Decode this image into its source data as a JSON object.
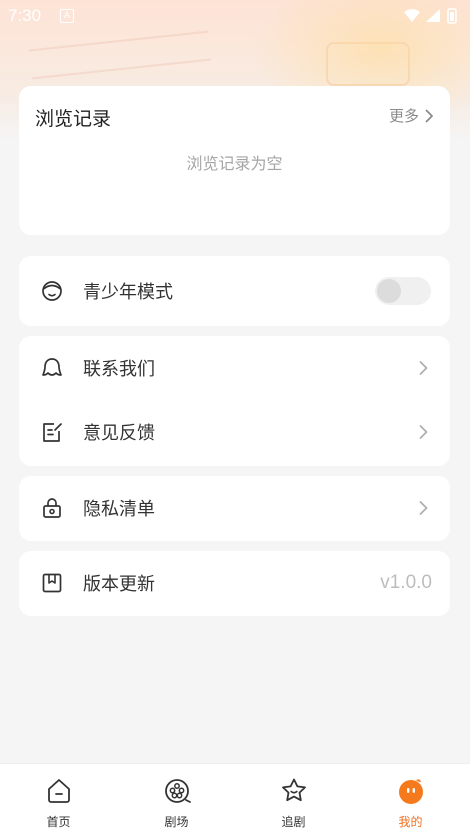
{
  "status_bar": {
    "time": "7:30",
    "indicator": "A"
  },
  "history": {
    "title": "浏览记录",
    "more_label": "更多",
    "empty_text": "浏览记录为空"
  },
  "youth_mode": {
    "label": "青少年模式",
    "enabled": false
  },
  "menu": {
    "contact_label": "联系我们",
    "feedback_label": "意见反馈",
    "privacy_label": "隐私清单",
    "update_label": "版本更新",
    "version": "v1.0.0"
  },
  "tabbar": {
    "tabs": [
      {
        "label": "首页",
        "icon": "home-icon"
      },
      {
        "label": "剧场",
        "icon": "film-reel-icon"
      },
      {
        "label": "追剧",
        "icon": "star-icon"
      },
      {
        "label": "我的",
        "icon": "profile-mascot-icon"
      }
    ],
    "active_color": "#f07020"
  }
}
